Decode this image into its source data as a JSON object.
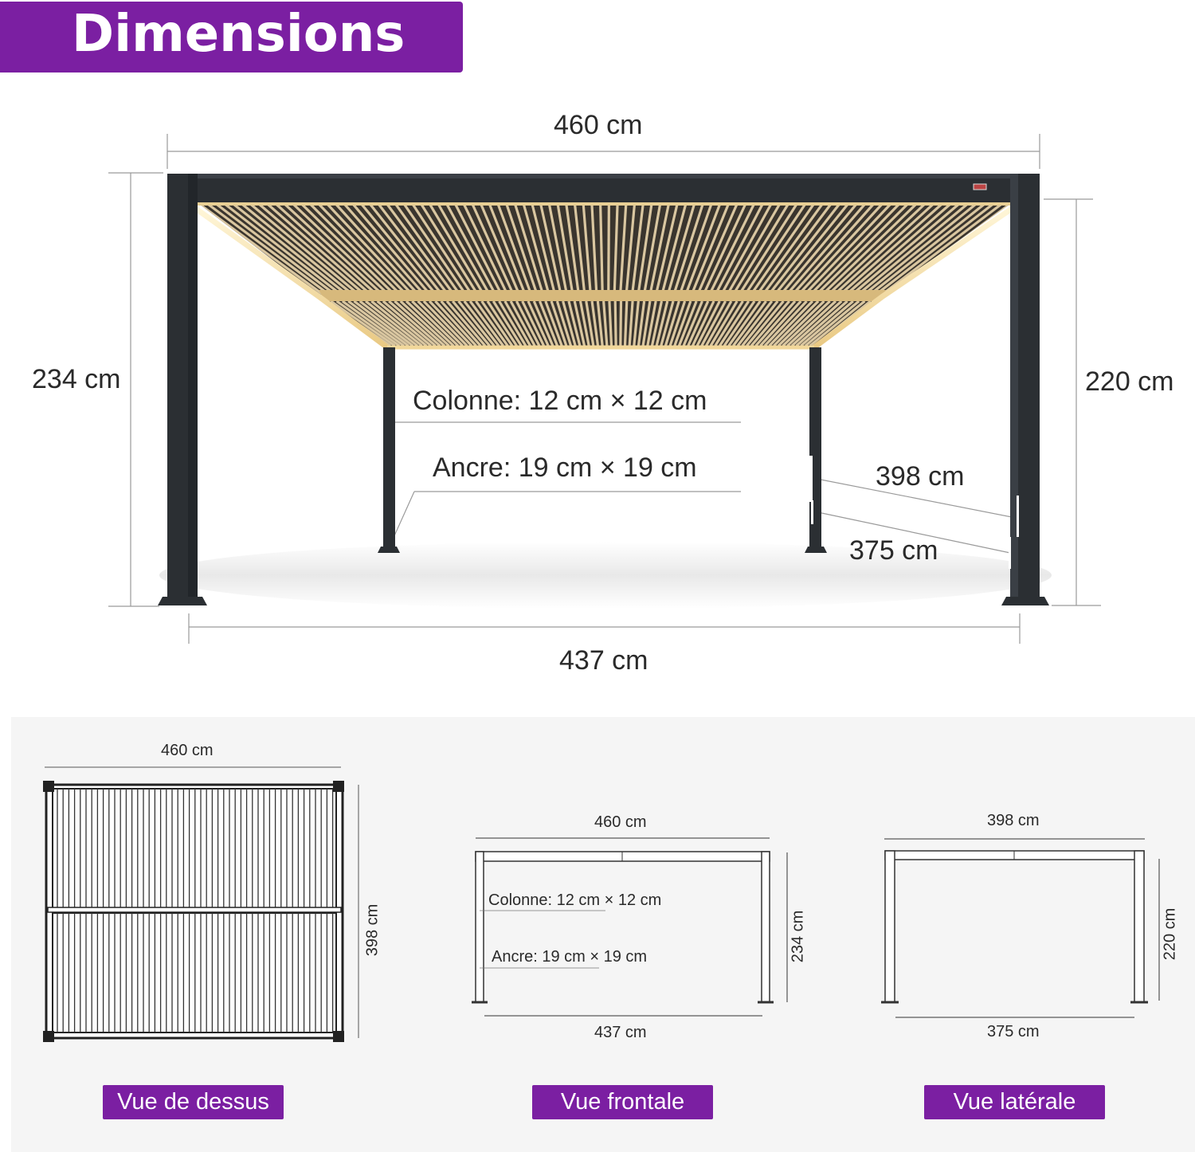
{
  "header": {
    "title": "Dimensions"
  },
  "main_view": {
    "top_width": "460 cm",
    "bottom_width": "437 cm",
    "left_height": "234 cm",
    "right_height": "220 cm",
    "column": "Colonne: 12 cm × 12 cm",
    "anchor": "Ancre: 19 cm  × 19 cm",
    "depth_outer": "398 cm",
    "depth_inner": "375 cm"
  },
  "top_view": {
    "width": "460 cm",
    "depth": "398 cm",
    "label": "Vue de dessus"
  },
  "front_view": {
    "top_width": "460 cm",
    "bottom_width": "437 cm",
    "height": "234 cm",
    "column": "Colonne: 12 cm × 12 cm",
    "anchor": "Ancre: 19 cm  × 19 cm",
    "label": "Vue frontale"
  },
  "side_view": {
    "top_width": "398 cm",
    "bottom_width": "375 cm",
    "height": "220 cm",
    "label": "Vue latérale"
  },
  "colors": {
    "accent": "#7b1fa2",
    "frame": "#2b2f33",
    "led": "#f3d28a"
  }
}
